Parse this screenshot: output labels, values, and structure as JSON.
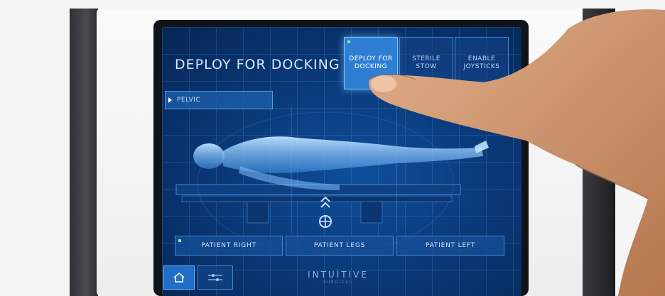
{
  "screen": {
    "title": "DEPLOY FOR DOCKING",
    "top_buttons": [
      {
        "label": "DEPLOY FOR DOCKING",
        "active": true
      },
      {
        "label": "STERILE STOW",
        "active": false
      },
      {
        "label": "ENABLE JOYSTICKS",
        "active": false
      }
    ],
    "procedure_selector": {
      "label": "PELVIC"
    },
    "position_buttons": [
      {
        "label": "PATIENT RIGHT",
        "active": true
      },
      {
        "label": "PATIENT LEGS",
        "active": false
      },
      {
        "label": "PATIENT LEFT",
        "active": false
      }
    ],
    "footer": {
      "home_icon": "home-icon",
      "adjust_icon": "adjust-sliders-icon",
      "logo_text": "INTUİTIVE",
      "logo_subtext": "SURGICAL"
    }
  },
  "colors": {
    "screen_bg": "#0a3a7a",
    "accent": "#2e7fd4",
    "indicator": "#7dff8a"
  }
}
